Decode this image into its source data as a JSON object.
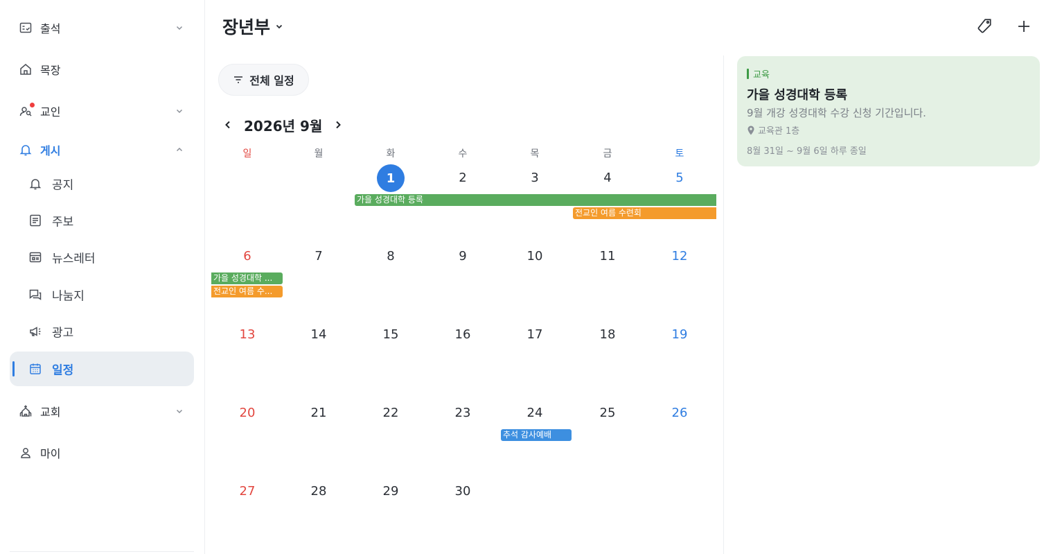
{
  "sidebar": {
    "items": [
      {
        "label": "출석",
        "icon": "attendance-icon",
        "expandable": true
      },
      {
        "label": "목장",
        "icon": "home-icon",
        "expandable": false
      },
      {
        "label": "교인",
        "icon": "members-icon",
        "expandable": true,
        "notification_dot": true
      },
      {
        "label": "게시",
        "icon": "bell-icon",
        "expandable": true,
        "expanded": true
      },
      {
        "label": "교회",
        "icon": "church-icon",
        "expandable": true
      },
      {
        "label": "마이",
        "icon": "user-icon",
        "expandable": false
      }
    ],
    "sub_items": [
      {
        "label": "공지",
        "icon": "bell-icon"
      },
      {
        "label": "주보",
        "icon": "bulletin-icon"
      },
      {
        "label": "뉴스레터",
        "icon": "newsletter-icon"
      },
      {
        "label": "나눔지",
        "icon": "chat-icon"
      },
      {
        "label": "광고",
        "icon": "megaphone-icon"
      },
      {
        "label": "일정",
        "icon": "calendar-icon",
        "selected": true
      }
    ]
  },
  "header": {
    "title": "장년부",
    "actions": [
      "tag-icon",
      "plus-icon"
    ]
  },
  "filter": {
    "label": "전체 일정"
  },
  "calendar": {
    "month_label": "2026년 9월",
    "weekdays": [
      "일",
      "월",
      "화",
      "수",
      "목",
      "금",
      "토"
    ],
    "weeks": [
      [
        "",
        "",
        "1",
        "2",
        "3",
        "4",
        "5"
      ],
      [
        "6",
        "7",
        "8",
        "9",
        "10",
        "11",
        "12"
      ],
      [
        "13",
        "14",
        "15",
        "16",
        "17",
        "18",
        "19"
      ],
      [
        "20",
        "21",
        "22",
        "23",
        "24",
        "25",
        "26"
      ],
      [
        "27",
        "28",
        "29",
        "30",
        "",
        "",
        ""
      ]
    ],
    "today": "1",
    "events": [
      {
        "title": "가을 성경대학 등록",
        "short": "가을 성경대학 ...",
        "color": "#5aac5e"
      },
      {
        "title": "전교인 여름 수련회",
        "short": "전교인 여름 수...",
        "color": "#f49b2c"
      },
      {
        "title": "추석 감사예배",
        "color": "#3d8fe0"
      }
    ]
  },
  "detail": {
    "category": "교육",
    "title": "가을 성경대학 등록",
    "description": "9월 개강 성경대학 수강 신청 기간입니다.",
    "location": "교육관 1층",
    "date_range": "8월 31일 ~ 9월 6일 하루 종일",
    "accent": "#3e9b46",
    "background": "#e4f1e4"
  }
}
